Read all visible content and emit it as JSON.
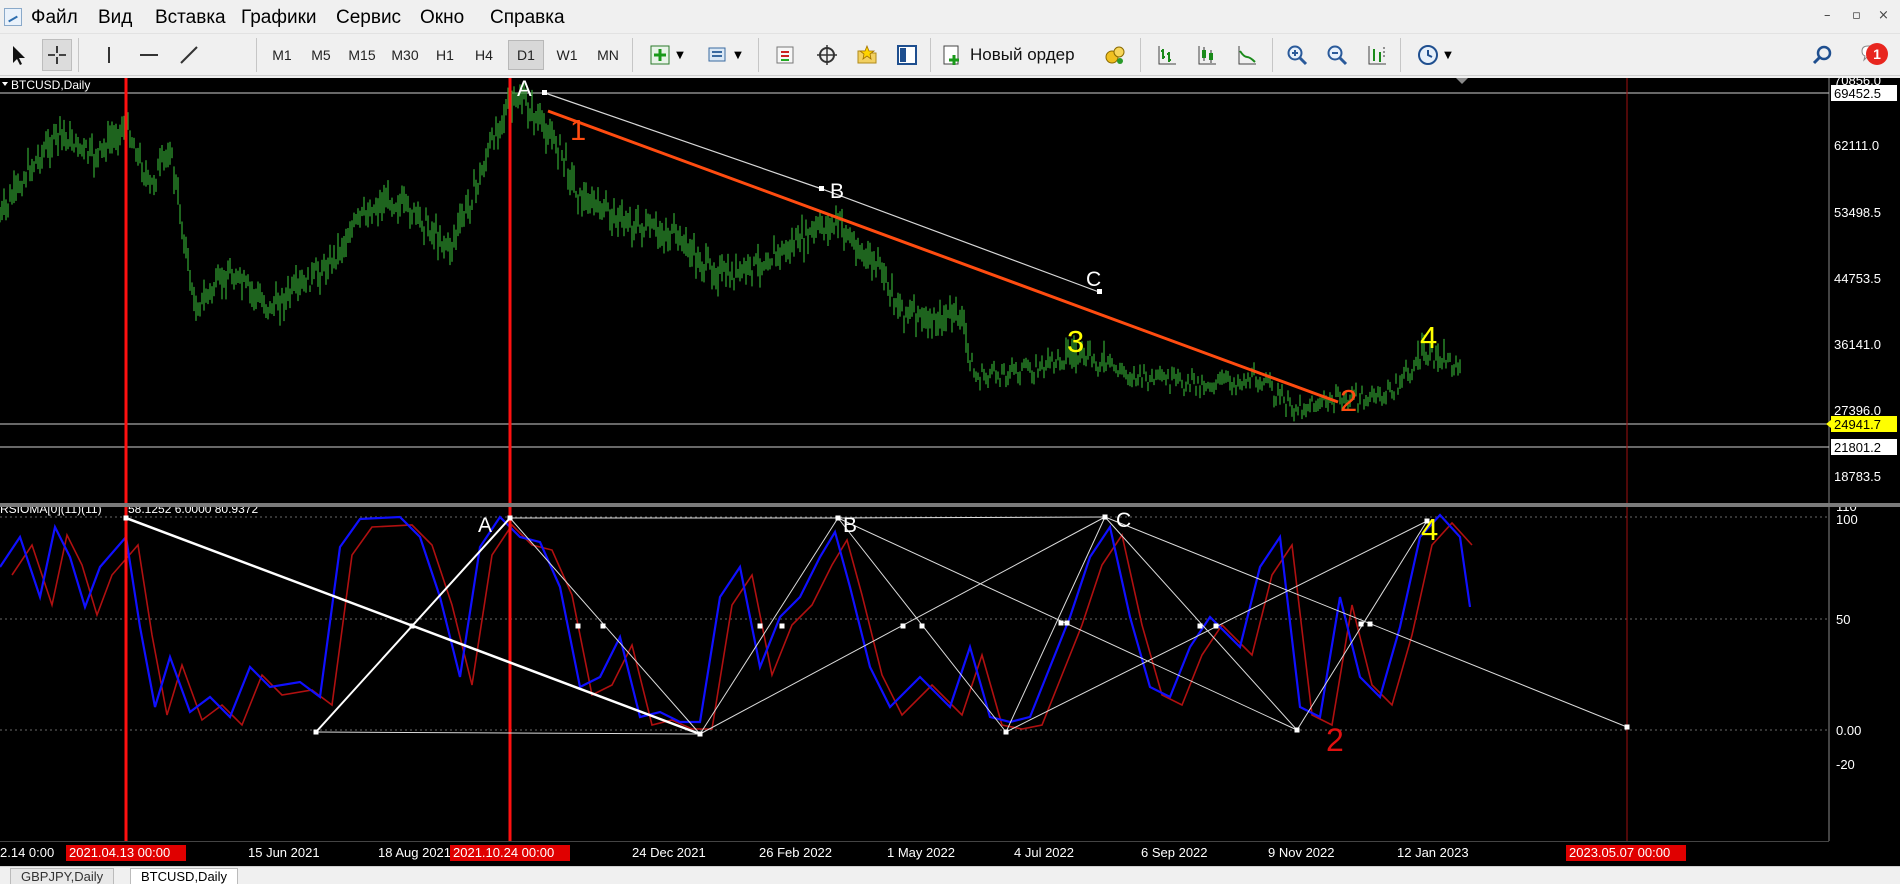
{
  "menu": {
    "items": [
      "Файл",
      "Вид",
      "Вставка",
      "Графики",
      "Сервис",
      "Окно",
      "Справка"
    ],
    "window_controls": [
      "–",
      "▫",
      "×"
    ]
  },
  "toolbar": {
    "timeframes": [
      "M1",
      "M5",
      "M15",
      "M30",
      "H1",
      "H4",
      "D1",
      "W1",
      "MN"
    ],
    "active_timeframe": "D1",
    "new_order_label": "Новый ордер",
    "notification_count": "1"
  },
  "chart": {
    "symbol_label": "BTCUSD,Daily",
    "price_axis_labels": [
      "70856.0",
      "62111.0",
      "53498.5",
      "44753.5",
      "36141.0",
      "27396.0",
      "18783.5"
    ],
    "price_marker_top": "69452.5",
    "price_marker_current": "24941.7",
    "price_marker_level": "21801.2",
    "wave_labels_main": [
      "A",
      "B",
      "C",
      "1",
      "2",
      "3",
      "4"
    ],
    "indicator_label": "RSIOMA[0](11)(11)",
    "indicator_values": "58.1252 6.0000 80.9372",
    "indicator_axis_labels": [
      "110",
      "100",
      "50",
      "0.00",
      "-20"
    ],
    "wave_labels_indicator": [
      "A",
      "B",
      "C",
      "2",
      "4"
    ],
    "date_labels": [
      "15 Jun 2021",
      "18 Aug 2021",
      "24 Dec 2021",
      "26 Feb 2022",
      "1 May 2022",
      "4 Jul 2022",
      "6 Sep 2022",
      "9 Nov 2022",
      "12 Jan 2023"
    ],
    "date_label_partial_left": "2.14 0:00",
    "date_marker_1": "2021.04.13 00:00",
    "date_marker_2": "2021.10.24 00:00",
    "date_marker_3": "2023.05.07 00:00",
    "colors": {
      "background": "#000000",
      "candles": "#2e9a2e",
      "red_vline": "#ff0000",
      "trend_orange": "#ff4500",
      "label_yellow": "#ffff00",
      "rsi_blue": "#0000ff",
      "rsi_red": "#b01010",
      "grid": "#444444"
    }
  },
  "tabs": {
    "items": [
      "GBPJPY,Daily",
      "BTCUSD,Daily"
    ],
    "active": "BTCUSD,Daily"
  }
}
